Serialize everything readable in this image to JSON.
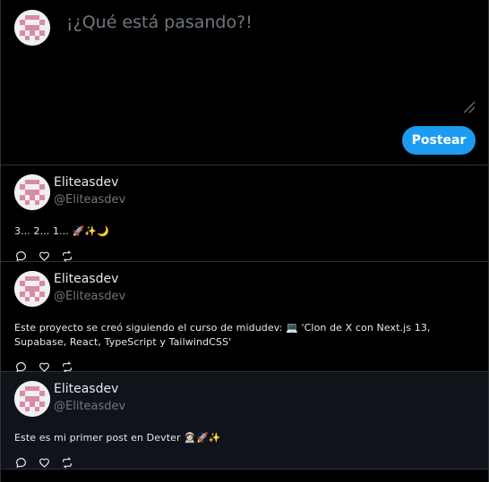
{
  "composer": {
    "placeholder": "¡¿Qué está pasando?!",
    "post_label": "Postear"
  },
  "colors": {
    "background": "#000000",
    "border": "#2f3336",
    "accent": "#1d9bf0",
    "avatar_pink": "#d98aa8",
    "muted": "#71767b",
    "highlight_row": "#0f131a"
  },
  "posts": [
    {
      "author_name": "Eliteasdev",
      "author_handle": "@Eliteasdev",
      "text": "3... 2... 1... 🚀✨🌙"
    },
    {
      "author_name": "Eliteasdev",
      "author_handle": "@Eliteasdev",
      "text": "Este proyecto se creó siguiendo el curso de midudev: 💻 'Clon de X con Next.js 13, Supabase, React, TypeScript y TailwindCSS'"
    },
    {
      "author_name": "Eliteasdev",
      "author_handle": "@Eliteasdev",
      "text": "Este es mi primer post en Devter 👩🏻‍🚀🚀✨"
    }
  ],
  "icons": {
    "comment": "comment-icon",
    "like": "heart-icon",
    "repost": "repost-icon"
  }
}
